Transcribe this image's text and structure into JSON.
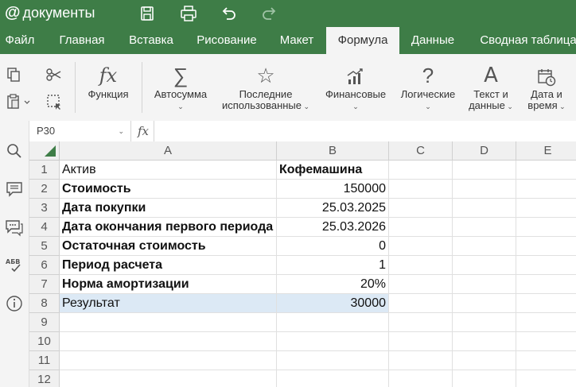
{
  "app": {
    "brand": "документы",
    "brand_at": "@"
  },
  "titlebar_icons": [
    "save-icon",
    "print-icon",
    "undo-icon",
    "redo-icon"
  ],
  "tabs": [
    "Файл",
    "Главная",
    "Вставка",
    "Рисование",
    "Макет",
    "Формула",
    "Данные",
    "Сводная таблица"
  ],
  "active_tab": "Формула",
  "toolbar": {
    "function": "Функция",
    "autosum": "Автосумма",
    "recent_1": "Последние",
    "recent_2": "использованные",
    "financial": "Финансовые",
    "logical": "Логические",
    "text_1": "Текст и",
    "text_2": "данные",
    "date_1": "Дата и",
    "date_2": "время"
  },
  "formula_bar": {
    "name_box": "P30",
    "fx": "fx",
    "formula": ""
  },
  "columns": [
    "A",
    "B",
    "C",
    "D",
    "E"
  ],
  "rows": [
    {
      "n": "1",
      "a": "Актив",
      "b": "Кофемашина",
      "a_bold": false,
      "b_bold": true,
      "b_align": "left"
    },
    {
      "n": "2",
      "a": "Стоимость",
      "b": "150000",
      "a_bold": true,
      "b_bold": false,
      "b_align": "right"
    },
    {
      "n": "3",
      "a": "Дата покупки",
      "b": "25.03.2025",
      "a_bold": true,
      "b_bold": false,
      "b_align": "right"
    },
    {
      "n": "4",
      "a": "Дата окончания первого периода",
      "b": "25.03.2026",
      "a_bold": true,
      "b_bold": false,
      "b_align": "right"
    },
    {
      "n": "5",
      "a": "Остаточная стоимость",
      "b": "0",
      "a_bold": true,
      "b_bold": false,
      "b_align": "right"
    },
    {
      "n": "6",
      "a": "Период расчета",
      "b": "1",
      "a_bold": true,
      "b_bold": false,
      "b_align": "right"
    },
    {
      "n": "7",
      "a": "Норма амортизации",
      "b": "20%",
      "a_bold": true,
      "b_bold": false,
      "b_align": "right"
    },
    {
      "n": "8",
      "a": "Результат",
      "b": "30000",
      "a_bold": false,
      "b_bold": false,
      "b_align": "right",
      "highlight": true
    },
    {
      "n": "9",
      "a": "",
      "b": ""
    },
    {
      "n": "10",
      "a": "",
      "b": ""
    },
    {
      "n": "11",
      "a": "",
      "b": ""
    },
    {
      "n": "12",
      "a": "",
      "b": ""
    }
  ],
  "colors": {
    "brand": "#3e7d47",
    "highlight": "#dce9f5"
  }
}
